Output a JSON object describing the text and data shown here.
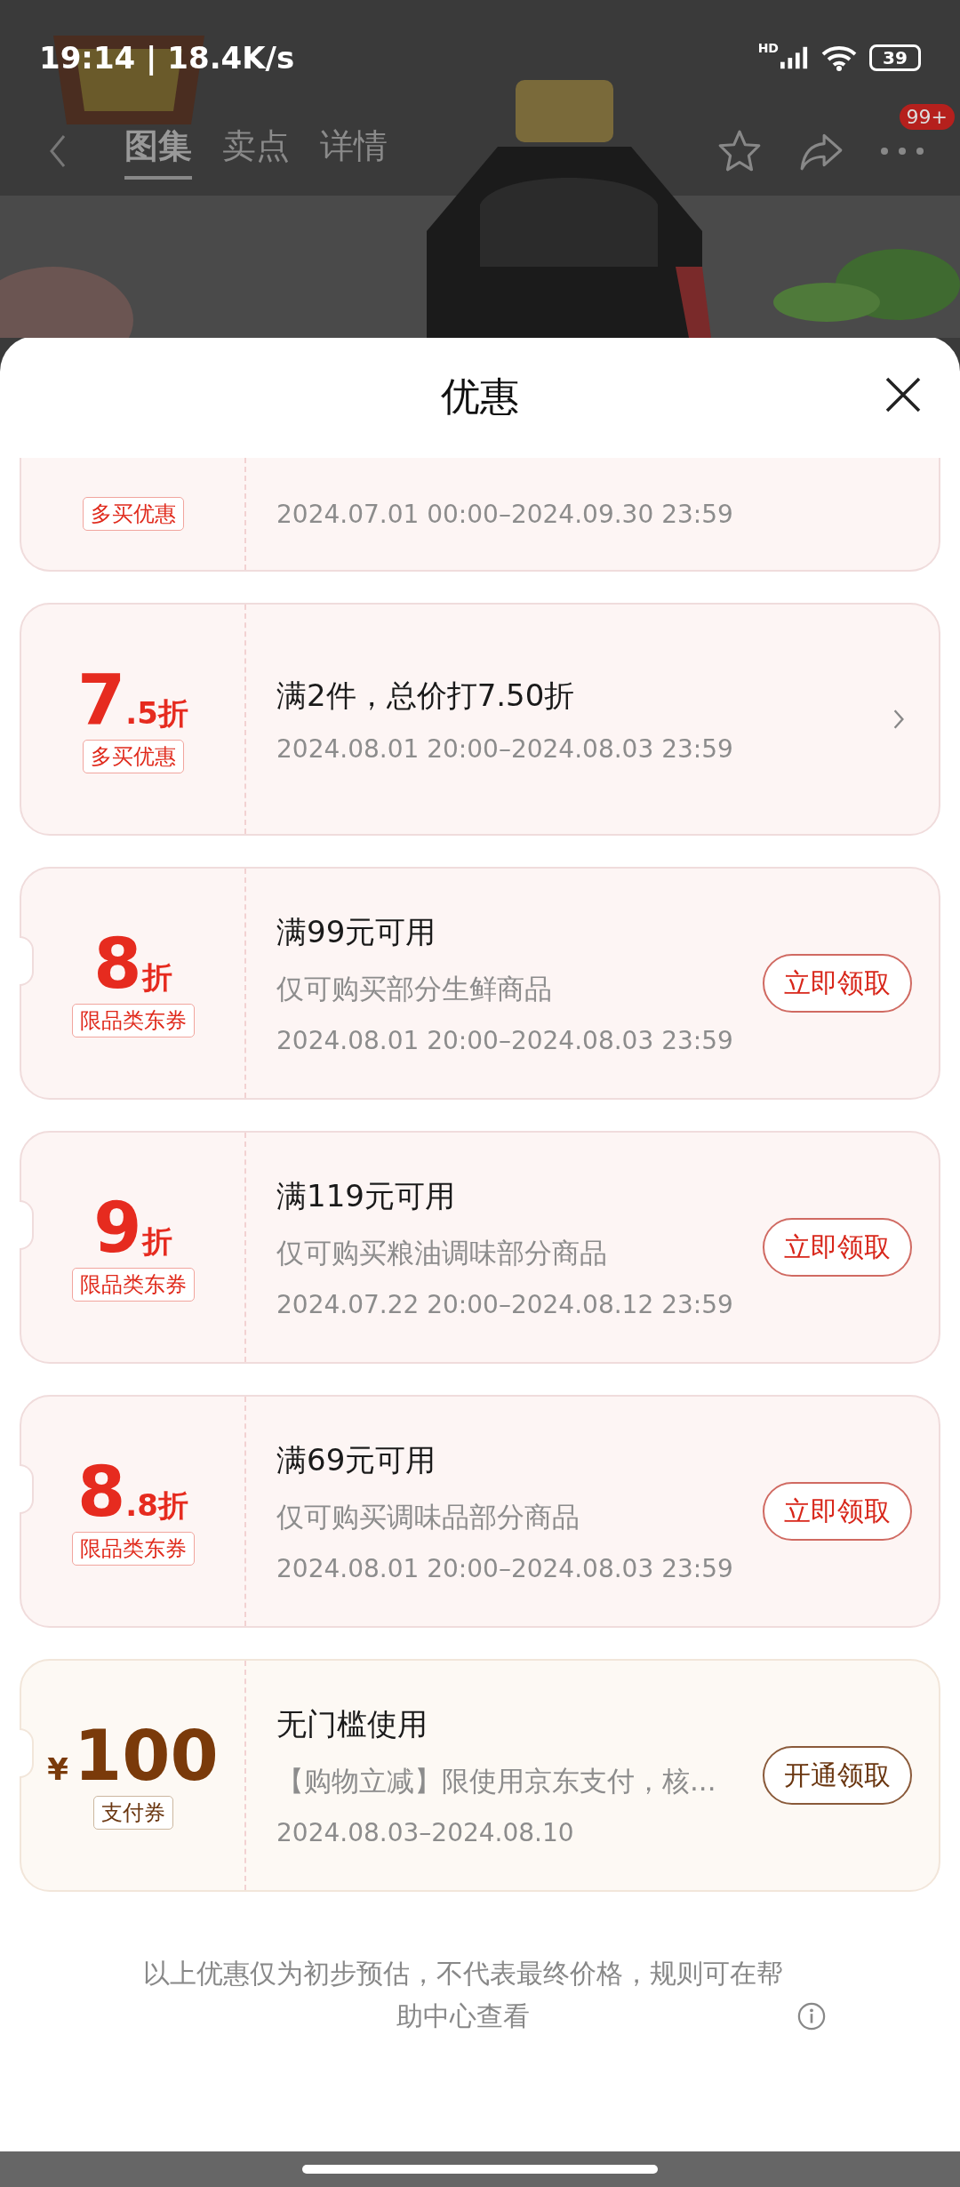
{
  "status_bar": {
    "time_speed": "19:14 | 18.4K/s",
    "network": "HD",
    "battery": "39"
  },
  "nav": {
    "tabs": [
      {
        "label": "图集",
        "selected": true
      },
      {
        "label": "卖点",
        "selected": false
      },
      {
        "label": "详情",
        "selected": false
      }
    ],
    "more_badge": "99+"
  },
  "sheet": {
    "title": "优惠",
    "offers": [
      {
        "kind": "discount",
        "cut_top": true,
        "notch": false,
        "tag": "多买优惠",
        "date": "2024.07.01 00:00–2024.09.30 23:59"
      },
      {
        "kind": "discount",
        "cut_top": false,
        "notch": false,
        "amount_main": "7",
        "amount_sub": ".5",
        "unit": "折",
        "tag": "多买优惠",
        "title": "满2件，总价打7.50折",
        "date": "2024.08.01 20:00–2024.08.03 23:59",
        "arrow": true
      },
      {
        "kind": "discount",
        "cut_top": false,
        "notch": true,
        "amount_main": "8",
        "unit": "折",
        "tag": "限品类东券",
        "title": "满99元可用",
        "subtitle": "仅可购买部分生鲜商品",
        "date": "2024.08.01 20:00–2024.08.03 23:59",
        "button": "立即领取"
      },
      {
        "kind": "discount",
        "cut_top": false,
        "notch": true,
        "amount_main": "9",
        "unit": "折",
        "tag": "限品类东券",
        "title": "满119元可用",
        "subtitle": "仅可购买粮油调味部分商品",
        "date": "2024.07.22 20:00–2024.08.12 23:59",
        "button": "立即领取"
      },
      {
        "kind": "discount",
        "cut_top": false,
        "notch": true,
        "amount_main": "8",
        "amount_sub": ".8",
        "unit": "折",
        "tag": "限品类东券",
        "title": "满69元可用",
        "subtitle": "仅可购买调味品部分商品",
        "date": "2024.08.01 20:00–2024.08.03 23:59",
        "button": "立即领取"
      },
      {
        "kind": "payment",
        "cut_top": false,
        "notch": true,
        "prefix": "¥",
        "amount_main": "100",
        "tag": "支付券",
        "title": "无门槛使用",
        "subtitle": "【购物立减】限使用京东支付，核...",
        "date": "2024.08.03–2024.08.10",
        "button": "开通领取"
      }
    ],
    "footer_note": "以上优惠仅为初步预估，不代表最终价格，规则可在帮助中心查看"
  }
}
